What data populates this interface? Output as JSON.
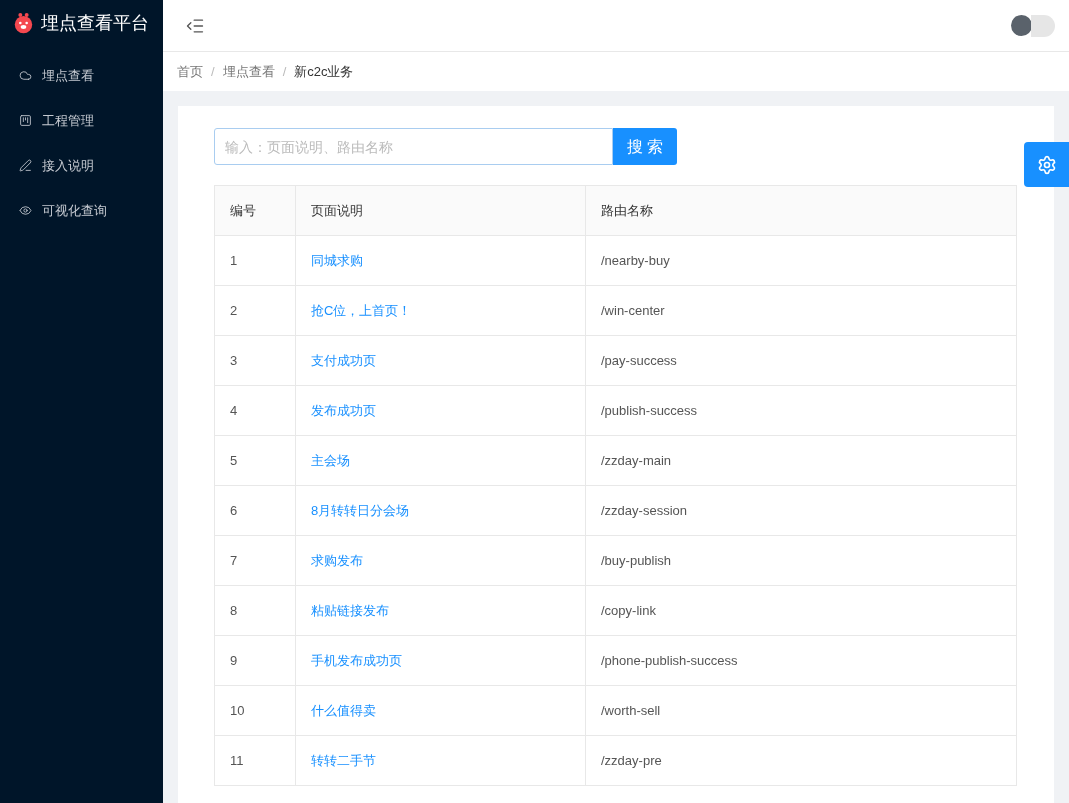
{
  "app": {
    "title": "埋点查看平台"
  },
  "sidebar": {
    "items": [
      {
        "label": "埋点查看",
        "kind": "cloud"
      },
      {
        "label": "工程管理",
        "kind": "project"
      },
      {
        "label": "接入说明",
        "kind": "edit"
      },
      {
        "label": "可视化查询",
        "kind": "eye"
      }
    ]
  },
  "breadcrumb": {
    "items": [
      "首页",
      "埋点查看",
      "新c2c业务"
    ],
    "separators": [
      "/",
      "/"
    ]
  },
  "search": {
    "placeholder": "输入：页面说明、路由名称",
    "button": "搜 索"
  },
  "table": {
    "columns": [
      "编号",
      "页面说明",
      "路由名称"
    ],
    "rows": [
      [
        "1",
        "同城求购",
        "/nearby-buy"
      ],
      [
        "2",
        "抢C位，上首页！",
        "/win-center"
      ],
      [
        "3",
        "支付成功页",
        "/pay-success"
      ],
      [
        "4",
        "发布成功页",
        "/publish-success"
      ],
      [
        "5",
        "主会场",
        "/zzday-main"
      ],
      [
        "6",
        "8月转转日分会场",
        "/zzday-session"
      ],
      [
        "7",
        "求购发布",
        "/buy-publish"
      ],
      [
        "8",
        "粘贴链接发布",
        "/copy-link"
      ],
      [
        "9",
        "手机发布成功页",
        "/phone-publish-success"
      ],
      [
        "10",
        "什么值得卖",
        "/worth-sell"
      ],
      [
        "11",
        "转转二手节",
        "/zzday-pre"
      ]
    ]
  }
}
